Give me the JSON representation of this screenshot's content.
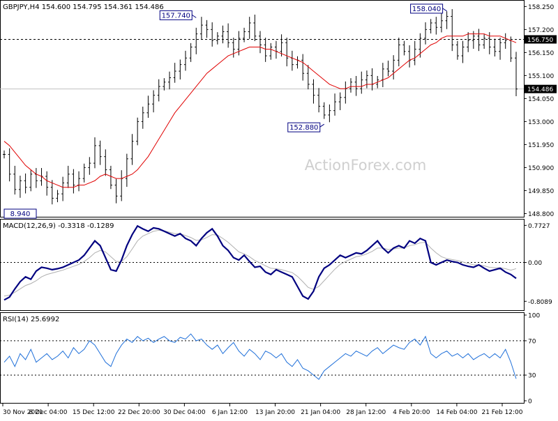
{
  "chart_data": [
    {
      "type": "ohlc",
      "panel": "price",
      "title": "GBPJPY,H4  154.600 154.795 154.361 154.486",
      "watermark": "ActionForex.com",
      "y_ticks": [
        "158.250",
        "157.200",
        "156.150",
        "155.100",
        "154.050",
        "153.000",
        "151.950",
        "150.900",
        "149.850",
        "148.800"
      ],
      "ylim": [
        148.75,
        158.42
      ],
      "level_line": {
        "label": "156.750",
        "value": 156.75,
        "style": "dashed"
      },
      "last_price": {
        "label": "154.486",
        "value": 154.486
      },
      "annotations": [
        {
          "text": "157.740",
          "value": 157.74
        },
        {
          "text": "152.880",
          "value": 152.88
        },
        {
          "text": "158.040",
          "value": 158.04
        },
        {
          "text": "8.940",
          "value": 148.94
        }
      ],
      "close_series": [
        151.5,
        150.6,
        149.9,
        150.3,
        150.0,
        150.6,
        150.3,
        150.5,
        150.0,
        149.5,
        149.7,
        150.2,
        150.6,
        150.1,
        150.4,
        150.9,
        151.1,
        151.9,
        151.4,
        150.8,
        150.1,
        149.6,
        150.4,
        151.3,
        152.1,
        153.0,
        153.4,
        153.8,
        154.2,
        154.6,
        154.8,
        155.0,
        155.3,
        155.6,
        155.9,
        156.4,
        157.0,
        157.4,
        157.2,
        156.7,
        156.9,
        157.1,
        156.6,
        156.3,
        156.8,
        157.1,
        157.5,
        156.9,
        156.5,
        156.0,
        156.4,
        156.2,
        156.6,
        155.9,
        155.6,
        155.8,
        155.2,
        154.7,
        154.2,
        153.7,
        153.3,
        153.5,
        153.9,
        154.1,
        154.5,
        154.8,
        154.5,
        154.9,
        155.1,
        154.7,
        154.9,
        155.4,
        155.3,
        155.8,
        156.5,
        156.2,
        155.8,
        156.3,
        156.8,
        157.2,
        157.5,
        157.3,
        157.6,
        157.8,
        156.5,
        156.0,
        156.4,
        156.7,
        156.9,
        156.5,
        156.8,
        156.4,
        156.2,
        156.6,
        156.7,
        155.9,
        154.486
      ],
      "moving_average_series": [
        152.1,
        151.9,
        151.6,
        151.3,
        151.0,
        150.8,
        150.6,
        150.5,
        150.3,
        150.2,
        150.1,
        150.0,
        150.0,
        150.0,
        150.1,
        150.1,
        150.2,
        150.3,
        150.5,
        150.6,
        150.5,
        150.4,
        150.4,
        150.5,
        150.6,
        150.8,
        151.1,
        151.4,
        151.8,
        152.2,
        152.6,
        153.0,
        153.4,
        153.7,
        154.0,
        154.3,
        154.6,
        154.9,
        155.2,
        155.4,
        155.6,
        155.8,
        156.0,
        156.1,
        156.2,
        156.3,
        156.4,
        156.4,
        156.4,
        156.3,
        156.3,
        156.2,
        156.1,
        156.0,
        155.9,
        155.8,
        155.7,
        155.5,
        155.3,
        155.1,
        154.9,
        154.7,
        154.6,
        154.5,
        154.5,
        154.6,
        154.6,
        154.6,
        154.7,
        154.7,
        154.8,
        154.9,
        155.0,
        155.2,
        155.4,
        155.6,
        155.8,
        155.9,
        156.1,
        156.3,
        156.5,
        156.6,
        156.8,
        156.9,
        156.9,
        156.9,
        156.9,
        157.0,
        157.0,
        157.0,
        157.0,
        156.9,
        156.9,
        156.9,
        156.8,
        156.7,
        156.6
      ],
      "x_tick_labels": [
        "30 Nov 2021",
        "8 Dec 04:00",
        "15 Dec 12:00",
        "22 Dec 20:00",
        "30 Dec 04:00",
        "6 Jan 12:00",
        "13 Jan 20:00",
        "21 Jan 04:00",
        "28 Jan 12:00",
        "4 Feb 20:00",
        "14 Feb 04:00",
        "21 Feb 12:00"
      ],
      "colors": {
        "bars": "#000000",
        "moving_average": "#e00000",
        "level_line": "#000000"
      }
    },
    {
      "type": "line",
      "panel": "macd",
      "title": "MACD(12,26,9) -0.3318 -0.1289",
      "y_ticks": [
        "0.7727",
        "0.00",
        "-0.8089"
      ],
      "ylim": [
        -0.95,
        0.85
      ],
      "zero_line": 0,
      "series": [
        {
          "values": [
            -0.78,
            -0.72,
            -0.55,
            -0.4,
            -0.3,
            -0.35,
            -0.18,
            -0.1,
            -0.12,
            -0.15,
            -0.13,
            -0.1,
            -0.05,
            0.0,
            0.05,
            0.15,
            0.3,
            0.45,
            0.35,
            0.1,
            -0.15,
            -0.18,
            0.05,
            0.35,
            0.58,
            0.76,
            0.7,
            0.65,
            0.72,
            0.7,
            0.65,
            0.6,
            0.55,
            0.6,
            0.5,
            0.45,
            0.35,
            0.5,
            0.62,
            0.7,
            0.55,
            0.35,
            0.25,
            0.1,
            0.05,
            0.15,
            0.02,
            -0.1,
            -0.08,
            -0.2,
            -0.25,
            -0.15,
            -0.2,
            -0.25,
            -0.3,
            -0.5,
            -0.7,
            -0.76,
            -0.6,
            -0.3,
            -0.12,
            -0.05,
            0.05,
            0.15,
            0.1,
            0.15,
            0.2,
            0.18,
            0.25,
            0.35,
            0.45,
            0.3,
            0.2,
            0.3,
            0.35,
            0.3,
            0.45,
            0.4,
            0.5,
            0.45,
            0.0,
            -0.05,
            0.0,
            0.05,
            0.02,
            0.0,
            -0.05,
            -0.08,
            -0.1,
            -0.05,
            -0.12,
            -0.18,
            -0.15,
            -0.12,
            -0.2,
            -0.25,
            -0.3318
          ]
        },
        {
          "values": [
            -0.7,
            -0.68,
            -0.62,
            -0.55,
            -0.48,
            -0.44,
            -0.38,
            -0.3,
            -0.25,
            -0.22,
            -0.19,
            -0.16,
            -0.12,
            -0.08,
            -0.04,
            0.02,
            0.1,
            0.2,
            0.25,
            0.22,
            0.12,
            0.02,
            0.02,
            0.12,
            0.28,
            0.45,
            0.55,
            0.6,
            0.65,
            0.67,
            0.66,
            0.63,
            0.6,
            0.6,
            0.56,
            0.52,
            0.46,
            0.47,
            0.52,
            0.58,
            0.57,
            0.5,
            0.42,
            0.32,
            0.22,
            0.18,
            0.12,
            0.04,
            -0.01,
            -0.07,
            -0.12,
            -0.13,
            -0.15,
            -0.18,
            -0.21,
            -0.29,
            -0.4,
            -0.52,
            -0.56,
            -0.5,
            -0.38,
            -0.26,
            -0.14,
            -0.04,
            0.02,
            0.07,
            0.12,
            0.14,
            0.18,
            0.23,
            0.3,
            0.3,
            0.27,
            0.28,
            0.3,
            0.3,
            0.35,
            0.37,
            0.41,
            0.42,
            0.3,
            0.2,
            0.12,
            0.08,
            0.06,
            0.04,
            0.01,
            -0.02,
            -0.05,
            -0.05,
            -0.07,
            -0.1,
            -0.11,
            -0.11,
            -0.13,
            -0.16,
            -0.1289
          ]
        }
      ],
      "colors": {
        "macd": "#000080",
        "signal": "#c0c0c0",
        "zero_line": "#000000"
      }
    },
    {
      "type": "line",
      "panel": "rsi",
      "title": "RSI(14) 25.6992",
      "y_ticks": [
        "100",
        "70",
        "30",
        "0"
      ],
      "ylim": [
        0,
        100
      ],
      "levels": [
        70,
        30
      ],
      "series": [
        {
          "values": [
            45,
            52,
            40,
            55,
            48,
            60,
            45,
            50,
            55,
            48,
            52,
            58,
            50,
            62,
            55,
            60,
            70,
            65,
            55,
            45,
            40,
            55,
            65,
            72,
            68,
            75,
            70,
            73,
            68,
            72,
            75,
            70,
            68,
            74,
            72,
            78,
            70,
            72,
            65,
            60,
            65,
            55,
            62,
            68,
            58,
            52,
            60,
            55,
            48,
            58,
            55,
            50,
            55,
            45,
            40,
            48,
            38,
            35,
            30,
            25,
            35,
            40,
            45,
            50,
            55,
            52,
            58,
            55,
            52,
            58,
            62,
            55,
            60,
            65,
            62,
            60,
            68,
            72,
            65,
            75,
            55,
            50,
            55,
            58,
            52,
            55,
            50,
            55,
            48,
            52,
            55,
            50,
            55,
            50,
            60,
            45,
            25.6992
          ]
        }
      ],
      "colors": {
        "rsi": "#1e6fd9",
        "levels": "#000000"
      }
    }
  ]
}
